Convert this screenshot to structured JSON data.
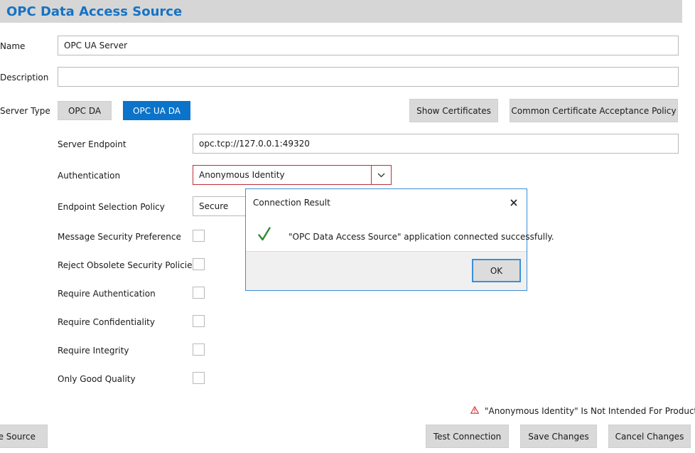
{
  "header": {
    "title": "OPC Data Access Source"
  },
  "form": {
    "name_label": "Name",
    "name_value": "OPC UA Server",
    "description_label": "Description",
    "description_value": "",
    "server_type_label": "Server Type",
    "server_type_options": [
      "OPC DA",
      "OPC UA DA"
    ],
    "server_type_selected": "OPC UA DA",
    "show_certificates_label": "Show Certificates",
    "cert_policy_label": "Common Certificate Acceptance Policy",
    "server_endpoint_label": "Server Endpoint",
    "server_endpoint_value": "opc.tcp://127.0.0.1:49320",
    "authentication_label": "Authentication",
    "authentication_value": "Anonymous Identity",
    "endpoint_policy_label": "Endpoint Selection Policy",
    "endpoint_policy_value": "Secure",
    "checkboxes": [
      {
        "label": "Message Security Preference",
        "checked": false
      },
      {
        "label": "Reject Obsolete Security Policies",
        "checked": false
      },
      {
        "label": "Require Authentication",
        "checked": false
      },
      {
        "label": "Require Confidentiality",
        "checked": false
      },
      {
        "label": "Require Integrity",
        "checked": false
      },
      {
        "label": "Only Good Quality",
        "checked": false
      }
    ]
  },
  "warning": {
    "text": "\"Anonymous Identity\" Is Not Intended For Production",
    "color": "#d13438",
    "icon": "warning-icon"
  },
  "footer": {
    "delete_label": "te Source",
    "test_connection_label": "Test Connection",
    "save_label": "Save Changes",
    "cancel_label": "Cancel Changes"
  },
  "dialog": {
    "title": "Connection Result",
    "message": "\"OPC Data Access Source\" application connected successfully.",
    "ok_label": "OK",
    "success_color": "#2e8b2e",
    "close_icon": "close-icon",
    "check_icon": "check-icon"
  },
  "colors": {
    "accent": "#0b73c9",
    "title": "#1672c4",
    "header_bg": "#d6d6d6",
    "error_border": "#c12d3b"
  }
}
